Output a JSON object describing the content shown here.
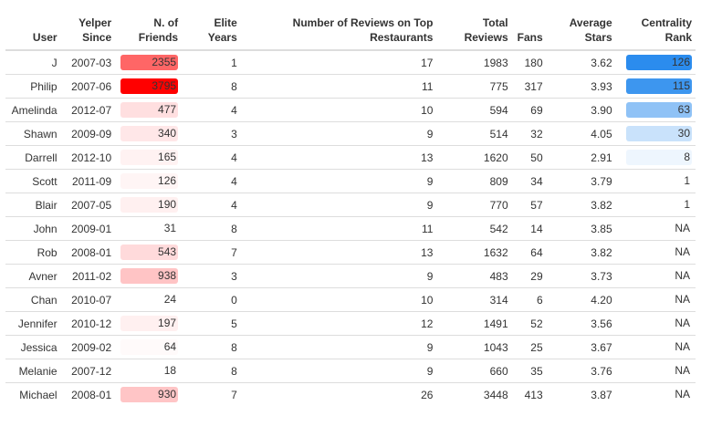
{
  "columns": [
    {
      "line1": "",
      "line2": "User"
    },
    {
      "line1": "Yelper",
      "line2": "Since"
    },
    {
      "line1": "N. of",
      "line2": "Friends"
    },
    {
      "line1": "Elite",
      "line2": "Years"
    },
    {
      "line1": "Number of Reviews on Top",
      "line2": "Restaurants"
    },
    {
      "line1": "Total",
      "line2": "Reviews"
    },
    {
      "line1": "",
      "line2": "Fans"
    },
    {
      "line1": "Average",
      "line2": "Stars"
    },
    {
      "line1": "Centrality",
      "line2": "Rank"
    }
  ],
  "rows": [
    {
      "user": "J",
      "since": "2007-03",
      "friends": "2355",
      "elite": "1",
      "top": "17",
      "total": "1983",
      "fans": "180",
      "avg": "3.62",
      "centrality": "126",
      "friends_color": "#ff6666",
      "centrality_color": "#2b8cee"
    },
    {
      "user": "Philip",
      "since": "2007-06",
      "friends": "3795",
      "elite": "8",
      "top": "11",
      "total": "775",
      "fans": "317",
      "avg": "3.93",
      "centrality": "115",
      "friends_color": "#ff0000",
      "centrality_color": "#3d96ef"
    },
    {
      "user": "Amelinda",
      "since": "2012-07",
      "friends": "477",
      "elite": "4",
      "top": "10",
      "total": "594",
      "fans": "69",
      "avg": "3.90",
      "centrality": "63",
      "friends_color": "#ffdfe0",
      "centrality_color": "#8fc2f6"
    },
    {
      "user": "Shawn",
      "since": "2009-09",
      "friends": "340",
      "elite": "3",
      "top": "9",
      "total": "514",
      "fans": "32",
      "avg": "4.05",
      "centrality": "30",
      "friends_color": "#ffe7e8",
      "centrality_color": "#c9e2fb"
    },
    {
      "user": "Darrell",
      "since": "2012-10",
      "friends": "165",
      "elite": "4",
      "top": "13",
      "total": "1620",
      "fans": "50",
      "avg": "2.91",
      "centrality": "8",
      "friends_color": "#fff2f2",
      "centrality_color": "#eef6fe"
    },
    {
      "user": "Scott",
      "since": "2011-09",
      "friends": "126",
      "elite": "4",
      "top": "9",
      "total": "809",
      "fans": "34",
      "avg": "3.79",
      "centrality": "1",
      "friends_color": "#fff5f5",
      "centrality_color": ""
    },
    {
      "user": "Blair",
      "since": "2007-05",
      "friends": "190",
      "elite": "4",
      "top": "9",
      "total": "770",
      "fans": "57",
      "avg": "3.82",
      "centrality": "1",
      "friends_color": "#fff0f0",
      "centrality_color": ""
    },
    {
      "user": "John",
      "since": "2009-01",
      "friends": "31",
      "elite": "8",
      "top": "11",
      "total": "542",
      "fans": "14",
      "avg": "3.85",
      "centrality": "NA",
      "friends_color": "",
      "centrality_color": ""
    },
    {
      "user": "Rob",
      "since": "2008-01",
      "friends": "543",
      "elite": "7",
      "top": "13",
      "total": "1632",
      "fans": "64",
      "avg": "3.82",
      "centrality": "NA",
      "friends_color": "#ffdadb",
      "centrality_color": ""
    },
    {
      "user": "Avner",
      "since": "2011-02",
      "friends": "938",
      "elite": "3",
      "top": "9",
      "total": "483",
      "fans": "29",
      "avg": "3.73",
      "centrality": "NA",
      "friends_color": "#ffc4c5",
      "centrality_color": ""
    },
    {
      "user": "Chan",
      "since": "2010-07",
      "friends": "24",
      "elite": "0",
      "top": "10",
      "total": "314",
      "fans": "6",
      "avg": "4.20",
      "centrality": "NA",
      "friends_color": "",
      "centrality_color": ""
    },
    {
      "user": "Jennifer",
      "since": "2010-12",
      "friends": "197",
      "elite": "5",
      "top": "12",
      "total": "1491",
      "fans": "52",
      "avg": "3.56",
      "centrality": "NA",
      "friends_color": "#fff0f0",
      "centrality_color": ""
    },
    {
      "user": "Jessica",
      "since": "2009-02",
      "friends": "64",
      "elite": "8",
      "top": "9",
      "total": "1043",
      "fans": "25",
      "avg": "3.67",
      "centrality": "NA",
      "friends_color": "#fffafa",
      "centrality_color": ""
    },
    {
      "user": "Melanie",
      "since": "2007-12",
      "friends": "18",
      "elite": "8",
      "top": "9",
      "total": "660",
      "fans": "35",
      "avg": "3.76",
      "centrality": "NA",
      "friends_color": "",
      "centrality_color": ""
    },
    {
      "user": "Michael",
      "since": "2008-01",
      "friends": "930",
      "elite": "7",
      "top": "26",
      "total": "3448",
      "fans": "413",
      "avg": "3.87",
      "centrality": "NA",
      "friends_color": "#ffc5c6",
      "centrality_color": ""
    }
  ]
}
